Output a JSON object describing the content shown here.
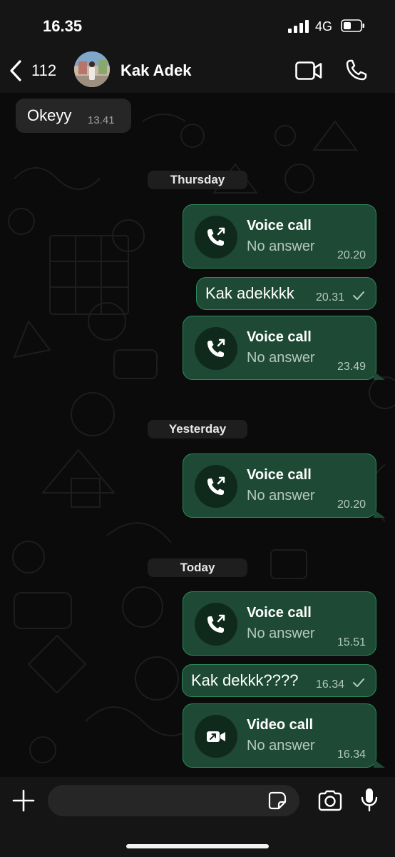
{
  "status_bar": {
    "time": "16.35",
    "network": "4G"
  },
  "header": {
    "back_count": "112",
    "contact_name": "Kak Adek"
  },
  "messages": {
    "incoming": {
      "text": "Okeyy",
      "time": "13.41"
    },
    "dates": [
      "Thursday",
      "Yesterday",
      "Today"
    ],
    "calls": [
      {
        "title": "Voice call",
        "status": "No answer",
        "time": "20.20"
      },
      {
        "title": "Voice call",
        "status": "No answer",
        "time": "23.49"
      },
      {
        "title": "Voice call",
        "status": "No answer",
        "time": "20.20"
      },
      {
        "title": "Voice call",
        "status": "No answer",
        "time": "15.51"
      },
      {
        "title": "Video call",
        "status": "No answer",
        "time": "16.34"
      }
    ],
    "outgoing": [
      {
        "text": "Kak adekkkk",
        "time": "20.31"
      },
      {
        "text": "Kak dekkk????",
        "time": "16.34"
      }
    ]
  },
  "input": {
    "placeholder": ""
  },
  "icons": {
    "back": "chevron-left-icon",
    "video": "video-camera-icon",
    "phone": "phone-icon",
    "missed_voice": "phone-outgoing-icon",
    "missed_video": "video-call-icon",
    "read": "checkmark-icon",
    "plus": "plus-icon",
    "sticker": "sticker-icon",
    "camera": "camera-icon",
    "mic": "microphone-icon"
  },
  "colors": {
    "background": "#0b0b0b",
    "bar": "#151515",
    "incoming_bubble": "#262626",
    "outgoing_bubble": "#1e4a35",
    "outgoing_border": "#2c8a5c"
  }
}
